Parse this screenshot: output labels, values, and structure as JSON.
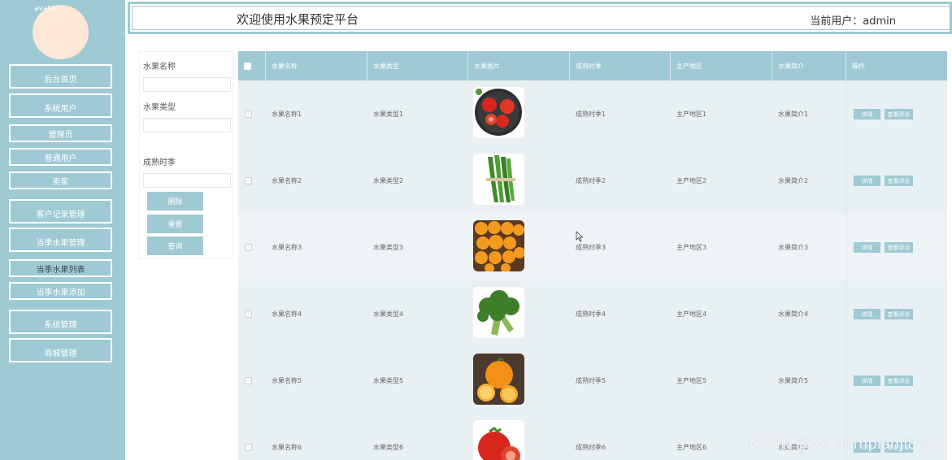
{
  "sidebar": {
    "avatar_alt": "avatar",
    "items": [
      {
        "label": "后台首页"
      },
      {
        "label": "系统用户"
      },
      {
        "label": "管理员"
      },
      {
        "label": "普通用户"
      },
      {
        "label": "卖家"
      },
      {
        "label": "客户记录管理"
      },
      {
        "label": "当季水果管理"
      },
      {
        "label": "当季水果列表"
      },
      {
        "label": "当季水果添加"
      },
      {
        "label": "系统管理"
      },
      {
        "label": "商城管理"
      }
    ]
  },
  "header": {
    "title": "欢迎使用水果预定平台",
    "user": "当前用户：admin"
  },
  "search": {
    "name_label": "水果名称",
    "type_label": "水果类型",
    "season_label": "成熟时季",
    "name_value": "",
    "type_value": "",
    "season_value": "",
    "delete_label": "删除",
    "reset_label": "重置",
    "query_label": "查询"
  },
  "table": {
    "columns": [
      "水果名称",
      "水果类型",
      "水果图片",
      "成熟时季",
      "主产地区",
      "水果简介",
      "操作"
    ],
    "detail_label": "详情",
    "comments_label": "查看评论",
    "rows": [
      {
        "name": "水果名称1",
        "type": "水果类型1",
        "image": "tomato-plate",
        "season": "成熟时季1",
        "region": "主产地区1",
        "intro": "水果简介1"
      },
      {
        "name": "水果名称2",
        "type": "水果类型2",
        "image": "okra",
        "season": "成熟时季2",
        "region": "主产地区2",
        "intro": "水果简介2"
      },
      {
        "name": "水果名称3",
        "type": "水果类型3",
        "image": "oranges-crate",
        "season": "成熟时季3",
        "region": "主产地区3",
        "intro": "水果简介3"
      },
      {
        "name": "水果名称4",
        "type": "水果类型4",
        "image": "broccoli",
        "season": "成熟时季4",
        "region": "主产地区4",
        "intro": "水果简介4"
      },
      {
        "name": "水果名称5",
        "type": "水果类型5",
        "image": "orange-sliced",
        "season": "成熟时季5",
        "region": "主产地区5",
        "intro": "水果简介5"
      },
      {
        "name": "水果名称6",
        "type": "水果类型6",
        "image": "tomato-sliced",
        "season": "成熟时季6",
        "region": "主产地区6",
        "intro": "水果简介6"
      }
    ]
  },
  "watermark": "CSDN @vx_dampianji889",
  "colors": {
    "accent": "#9fc9d3",
    "table_bg": "#e9f0f3"
  }
}
